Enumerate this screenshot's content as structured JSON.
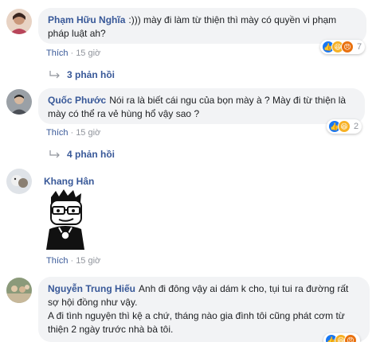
{
  "comments": [
    {
      "author": "Phạm Hữu Nghĩa",
      "text": ":))) mày đi làm từ thiện thì mày có quyền vi phạm pháp luật ah?",
      "like_label": "Thích",
      "time": "15 giờ",
      "reaction_count": "7",
      "replies_label": "3 phản hồi"
    },
    {
      "author": "Quốc Phước",
      "text": "Nói ra là biết cái ngu của bọn mày à ? Mày đi từ thiện là mày có thể ra vẻ hùng hổ vậy sao ?",
      "like_label": "Thích",
      "time": "15 giờ",
      "reaction_count": "2",
      "replies_label": "4 phản hồi"
    },
    {
      "author": "Khang Hân",
      "like_label": "Thích",
      "time": "15 giờ"
    },
    {
      "author": "Nguyễn Trung Hiếu",
      "text_line1": "Anh đi đông vậy ai dám k cho, tụi tui ra đường rất sợ hội đồng như vậy.",
      "text_line2": "A đi tình nguyện thì kệ a chứ, tháng nào gia đình tôi cũng phát cơm từ thiện 2 ngày trước nhà bà tôi."
    }
  ],
  "colors": {
    "link": "#385898",
    "bubble": "#f2f3f5",
    "meta": "#90949c",
    "like_reaction": "#1877f2",
    "haha_reaction": "#f7b125",
    "angry_reaction": "#e9710f"
  }
}
